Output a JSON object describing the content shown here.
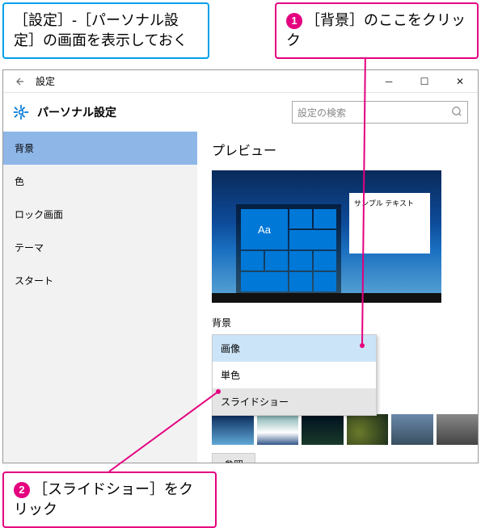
{
  "callouts": {
    "topLeft": "［設定］-［パーソナル設定］の画面を表示しておく",
    "topRight": "［背景］のここをクリック",
    "bottom": "［スライドショー］をクリック",
    "num1": "1",
    "num2": "2"
  },
  "window": {
    "title": "設定",
    "headerTitle": "パーソナル設定",
    "searchPlaceholder": "設定の検索"
  },
  "sidebar": {
    "items": [
      "背景",
      "色",
      "ロック画面",
      "テーマ",
      "スタート"
    ]
  },
  "main": {
    "previewTitle": "プレビュー",
    "sampleText": "サンプル テキスト",
    "aa": "Aa",
    "bgLabel": "背景",
    "dropdown": [
      "画像",
      "単色",
      "スライドショー"
    ],
    "browse": "参照"
  }
}
